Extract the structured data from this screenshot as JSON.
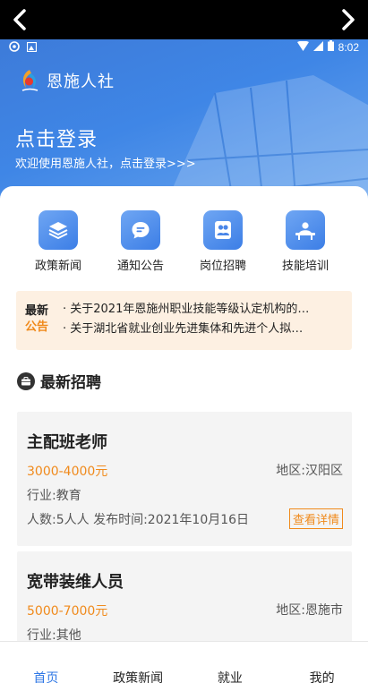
{
  "status_bar": {
    "time": "8:02"
  },
  "header": {
    "app_name": "恩施人社"
  },
  "login": {
    "title": "点击登录",
    "subtitle": "欢迎使用恩施人社，点击登录>>>"
  },
  "quick_links": [
    {
      "label": "政策新闻",
      "icon": "layers-icon"
    },
    {
      "label": "通知公告",
      "icon": "chat-bubble-icon"
    },
    {
      "label": "岗位招聘",
      "icon": "people-icon"
    },
    {
      "label": "技能培训",
      "icon": "teacher-icon"
    }
  ],
  "news": {
    "tag_top": "最新",
    "tag_bottom": "公告",
    "items": [
      "· 关于2021年恩施州职业技能等级认定机构的…",
      "· 关于湖北省就业创业先进集体和先进个人拟…"
    ]
  },
  "section": {
    "title": "最新招聘"
  },
  "jobs": [
    {
      "title": "主配班老师",
      "salary": "3000-4000元",
      "area": "地区:汉阳区",
      "industry": "行业:教育",
      "meta": "人数:5人人  发布时间:2021年10月16日",
      "detail_label": "查看详情"
    },
    {
      "title": "宽带装维人员",
      "salary": "5000-7000元",
      "area": "地区:恩施市",
      "industry": "行业:其他"
    }
  ],
  "tabs": [
    {
      "label": "首页",
      "active": true
    },
    {
      "label": "政策新闻"
    },
    {
      "label": "就业"
    },
    {
      "label": "我的"
    }
  ],
  "colors": {
    "primary": "#2e77e5",
    "accent": "#f08a1c",
    "news_bg": "#fdf0e2"
  }
}
